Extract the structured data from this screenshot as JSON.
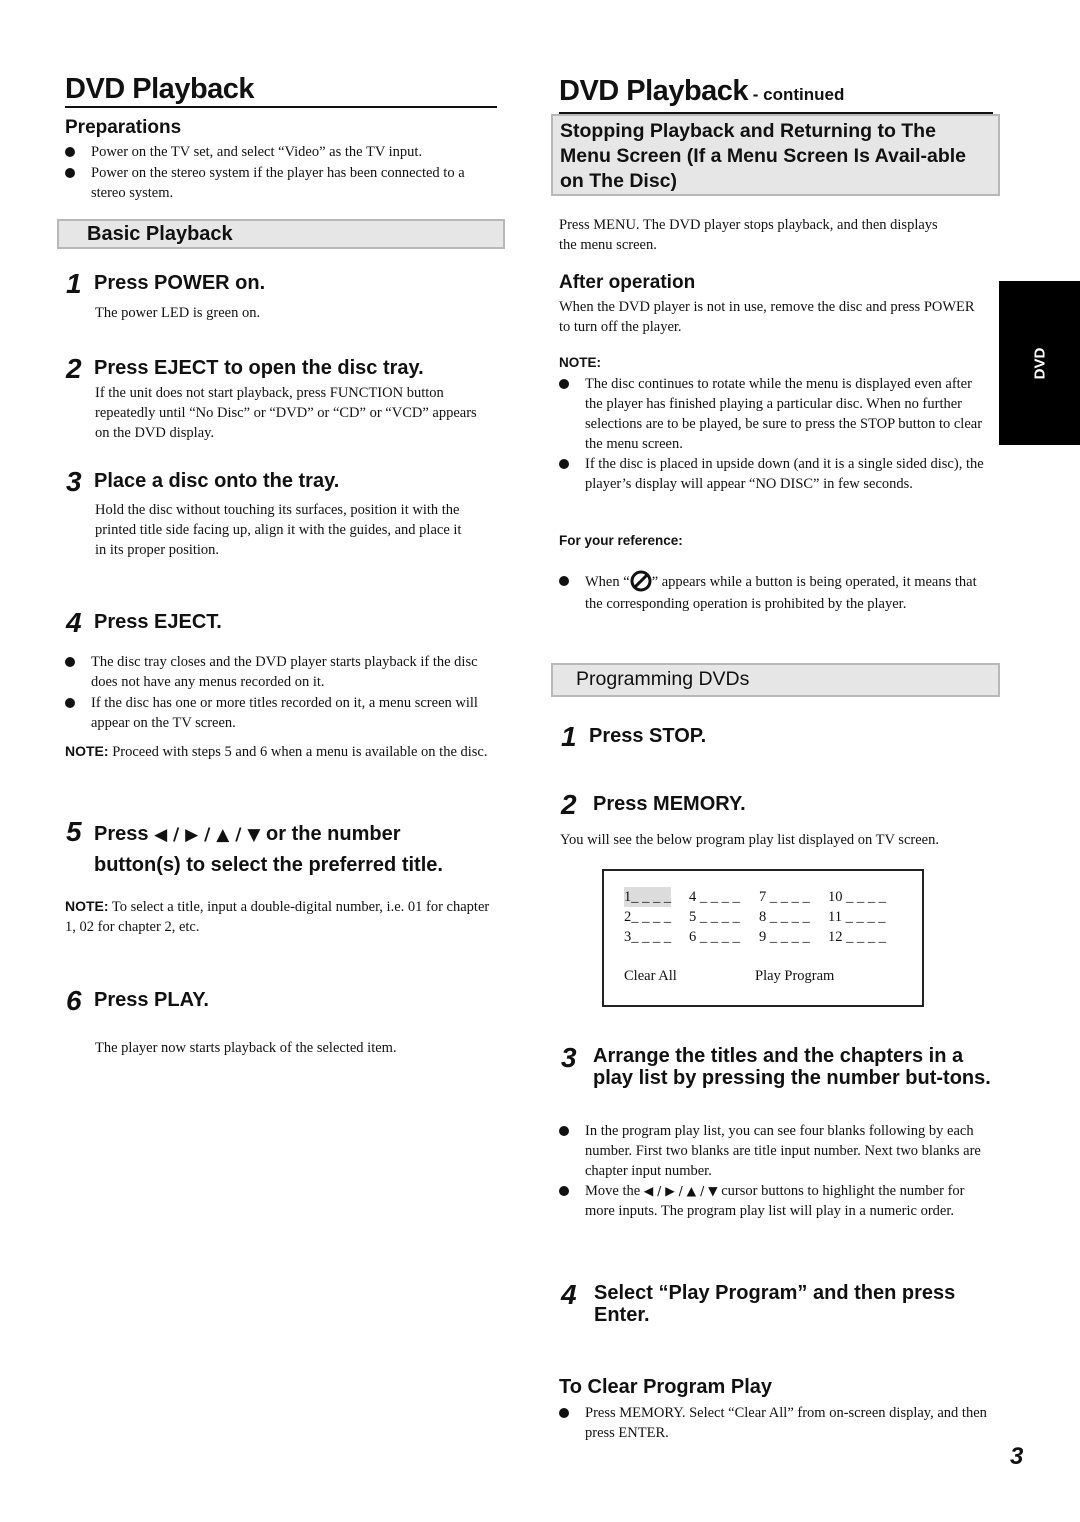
{
  "left": {
    "title": "DVD Playback",
    "preparations": {
      "heading": "Preparations",
      "bullets": [
        "Power on the TV set, and select “Video” as the TV input.",
        "Power on the stereo system if the player has been connected to a stereo system."
      ]
    },
    "basic_playback": {
      "heading": "Basic Playback",
      "steps": [
        {
          "num": "1",
          "title": "Press POWER on.",
          "body": "The power LED is green on."
        },
        {
          "num": "2",
          "title": "Press EJECT to open the disc tray.",
          "body": "If the unit does not start playback, press FUNCTION button repeatedly until “No Disc” or “DVD” or “CD” or “VCD” appears on the DVD display."
        },
        {
          "num": "3",
          "title": "Place a disc onto the tray.",
          "body": "Hold the disc without touching its surfaces, position it with the printed title side facing up, align it with the guides, and place it in its proper position."
        },
        {
          "num": "4",
          "title": "Press EJECT.",
          "bullets": [
            "The disc tray closes and the DVD player starts playback if the disc does not have any menus recorded on it.",
            "If the disc has one or more titles recorded on it, a menu screen will appear on the TV screen."
          ],
          "note_label": "NOTE:",
          "note": " Proceed with steps 5 and 6 when a menu is available on the disc."
        },
        {
          "num": "5",
          "title_prefix": "Press ",
          "title_arrows": "◀ / ▶ / ▲ / ▼",
          "title_suffix": " or the number button(s) to select the preferred title.",
          "note_label": "NOTE:",
          "note": " To select a title, input a double-digital number, i.e. 01 for chapter 1, 02 for chapter 2, etc."
        },
        {
          "num": "6",
          "title": "Press PLAY.",
          "body": "The player now starts playback of the selected item."
        }
      ]
    }
  },
  "right": {
    "title": "DVD Playback",
    "title_suffix": " - continued",
    "stopping": {
      "heading": "Stopping Playback and Returning to The Menu Screen (If a Menu Screen Is Avail-able on The Disc)",
      "body": "Press MENU.  The DVD player stops playback, and then displays the menu screen."
    },
    "after_operation": {
      "heading": "After operation",
      "body": "When the DVD player is not in use, remove the disc and press POWER to turn off the player.",
      "note_label": "NOTE:",
      "bullets": [
        "The disc continues to rotate while the menu is displayed even after the player has finished playing a particular disc. When no further selections are to be played, be sure to press the STOP button to clear the menu screen.",
        "If the disc is placed in upside down (and it is a single sided disc), the player’s display will appear  “NO DISC” in few seconds."
      ]
    },
    "reference": {
      "label": "For your reference:",
      "text_before": "When “",
      "icon": "prohibited-icon",
      "text_after": "” appears while a button is being operated, it means that the corresponding operation is prohibited by the player."
    },
    "programming": {
      "heading": "Programming DVDs",
      "step1": {
        "num": "1",
        "title": "Press STOP."
      },
      "step2": {
        "num": "2",
        "title": "Press MEMORY.",
        "body": "You will see the below program play list displayed on TV screen."
      },
      "program_list": {
        "cells": [
          "1_ _ _ _",
          "4 _ _ _ _",
          "7 _ _ _ _",
          "10 _ _ _ _",
          "2_ _ _ _",
          "5 _ _ _ _",
          "8 _ _ _ _",
          "11 _ _ _ _",
          "3_ _ _ _",
          "6 _ _ _ _",
          "9 _ _ _ _",
          "12 _ _ _ _"
        ],
        "selected_index": 0,
        "clear_all": "Clear All",
        "play_program": "Play Program"
      },
      "step3": {
        "num": "3",
        "title": "Arrange the titles and the chapters in a play list by pressing the number but-tons.",
        "bullets": [
          "In the program play list, you can see four blanks following by each number. First two blanks are title input number. Next two blanks are chapter input number."
        ],
        "bullet2_prefix": "Move the ",
        "bullet2_arrows": "◀ / ▶ / ▲ / ▼",
        "bullet2_suffix": " cursor buttons to highlight the number for more inputs. The program play list will play in a numeric order."
      },
      "step4": {
        "num": "4",
        "title": "Select “Play Program” and then press Enter."
      },
      "clear": {
        "heading": "To Clear Program Play",
        "bullets": [
          "Press MEMORY. Select “Clear All” from on-screen display, and then press ENTER."
        ]
      }
    }
  },
  "side_tab": "DVD",
  "page_number": "3"
}
